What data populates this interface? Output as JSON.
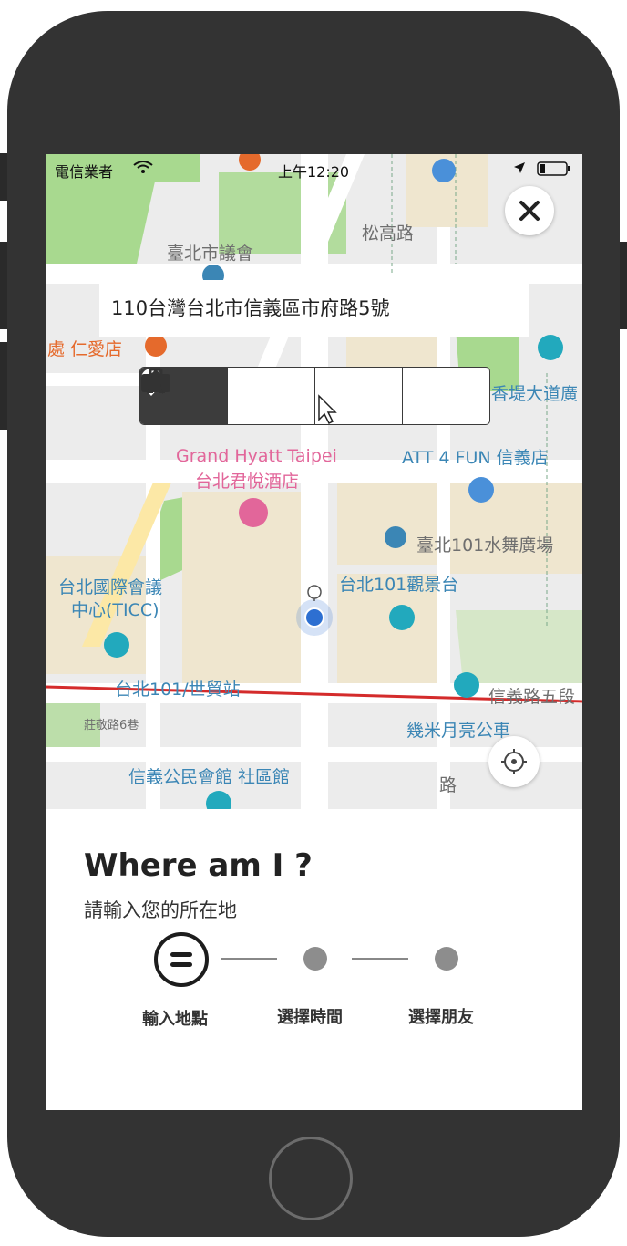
{
  "status_bar": {
    "carrier": "電信業者",
    "time": "上午12:20"
  },
  "map": {
    "labels": {
      "songgao_rd": "松高路",
      "city_council": "臺北市議會",
      "renai_plaza": "處 仁愛店",
      "shangri_la": "香堤大道廣",
      "att4fun": "ATT 4 FUN 信義店",
      "grand_hyatt_en": "Grand Hyatt Taipei",
      "grand_hyatt_zh": "台北君悅酒店",
      "water_dance": "臺北101水舞廣場",
      "ticc_1": "台北國際會議",
      "ticc_2": "中心(TICC)",
      "observatory": "台北101觀景台",
      "mrt_station": "台北101/世貿站",
      "xinyi_rd5": "信義路五段",
      "zhuangjing_rd": "莊敬路6巷",
      "moon_park": "幾米月亮公車",
      "civic_hall": "信義公民會館 社區館",
      "road_vertical": "路"
    },
    "address": "110台灣台北市信義區市府路5號",
    "categories": [
      {
        "icon": "map-pin-icon",
        "active": true
      },
      {
        "icon": "home-icon",
        "active": false
      },
      {
        "icon": "briefcase-icon",
        "active": false
      },
      {
        "icon": "star-icon",
        "active": false
      }
    ]
  },
  "sheet": {
    "title": "Where am I ?",
    "subtitle": "請輸入您的所在地",
    "steps": [
      {
        "label": "輸入地點",
        "state": "current"
      },
      {
        "label": "選擇時間",
        "state": "pending"
      },
      {
        "label": "選擇朋友",
        "state": "pending"
      }
    ]
  },
  "colors": {
    "accent_dark": "#222222",
    "user_location": "#2d6fd1",
    "mrt_line": "#d42b2b",
    "poi_teal": "#22a9bd",
    "poi_blue": "#4a90d9",
    "poi_pink": "#e2669a",
    "park_green": "#a8d98f"
  }
}
